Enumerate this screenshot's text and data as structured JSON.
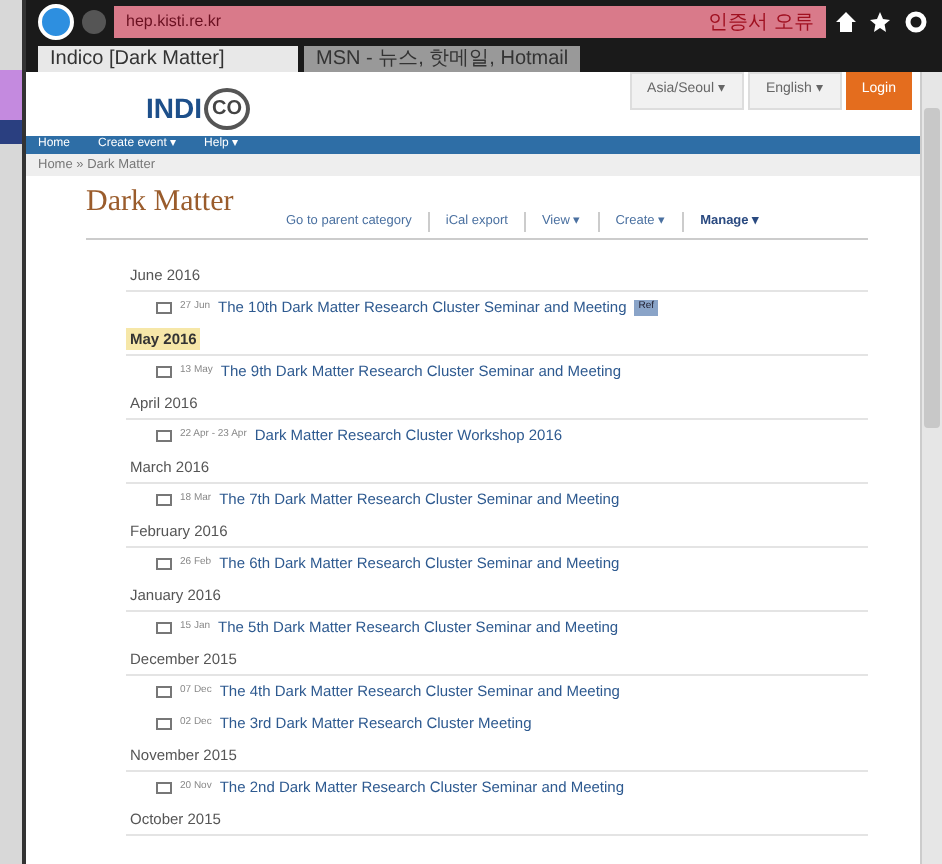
{
  "browser": {
    "address": "hep.kisti.re.kr",
    "cert_warning": "인증서 오류",
    "tabs": [
      {
        "label": "Indico [Dark Matter]",
        "selected": true
      },
      {
        "label": "MSN - 뉴스, 핫메일, Hotmail",
        "selected": false
      }
    ]
  },
  "header": {
    "logo": "INDI",
    "logo_mark": "CO",
    "timezone": "Asia/Seoul ▾",
    "language": "English ▾",
    "login": "Login"
  },
  "menu": [
    "Home",
    "Create event ▾",
    "Help ▾"
  ],
  "breadcrumb": "Home » Dark Matter",
  "category": {
    "title": "Dark Matter",
    "actions": [
      {
        "label": "Go to parent category",
        "bold": false
      },
      {
        "label": "iCal export",
        "bold": false
      },
      {
        "label": "View ▾",
        "bold": false
      },
      {
        "label": "Create ▾",
        "bold": false
      },
      {
        "label": "Manage ▾",
        "bold": true
      }
    ]
  },
  "months": [
    {
      "label": "June 2016",
      "selected": false,
      "events": [
        {
          "date": "27 Jun",
          "title": "The 10th Dark Matter Research Cluster Seminar and Meeting",
          "badge": "Ref"
        }
      ]
    },
    {
      "label": "May 2016",
      "selected": true,
      "events": [
        {
          "date": "13 May",
          "title": "The 9th Dark Matter Research Cluster Seminar and Meeting"
        }
      ]
    },
    {
      "label": "April 2016",
      "selected": false,
      "events": [
        {
          "date": "22 Apr - 23 Apr",
          "title": "Dark Matter Research Cluster Workshop 2016"
        }
      ]
    },
    {
      "label": "March 2016",
      "selected": false,
      "events": [
        {
          "date": "18 Mar",
          "title": "The 7th Dark Matter Research Cluster Seminar and Meeting"
        }
      ]
    },
    {
      "label": "February 2016",
      "selected": false,
      "events": [
        {
          "date": "26 Feb",
          "title": "The 6th Dark Matter Research Cluster Seminar and Meeting"
        }
      ]
    },
    {
      "label": "January 2016",
      "selected": false,
      "events": [
        {
          "date": "15 Jan",
          "title": "The 5th Dark Matter Research Cluster Seminar and Meeting"
        }
      ]
    },
    {
      "label": "December 2015",
      "selected": false,
      "events": [
        {
          "date": "07 Dec",
          "title": "The 4th Dark Matter Research Cluster Seminar and Meeting"
        },
        {
          "date": "02 Dec",
          "title": "The 3rd Dark Matter Research Cluster Meeting"
        }
      ]
    },
    {
      "label": "November 2015",
      "selected": false,
      "events": [
        {
          "date": "20 Nov",
          "title": "The 2nd Dark Matter Research Cluster Seminar and Meeting"
        }
      ]
    },
    {
      "label": "October 2015",
      "selected": false
    }
  ]
}
